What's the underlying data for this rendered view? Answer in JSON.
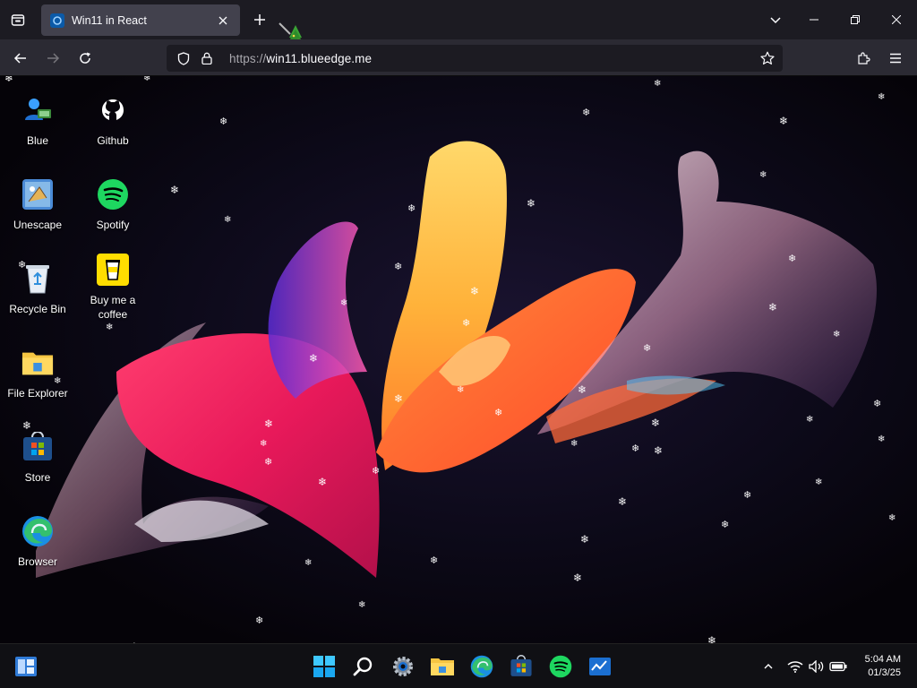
{
  "browser": {
    "tab_title": "Win11 in React",
    "url_dim": "https://",
    "url_main": "win11.blueedge.me"
  },
  "desktop": {
    "icons": [
      {
        "label": "Blue"
      },
      {
        "label": "Github"
      },
      {
        "label": "Unescape"
      },
      {
        "label": "Spotify"
      },
      {
        "label": "Recycle Bin"
      },
      {
        "label": "Buy me a coffee"
      },
      {
        "label": "File Explorer"
      },
      {
        "label": "Store"
      },
      {
        "label": "Browser"
      }
    ]
  },
  "taskbar": {
    "apps": [
      "widgets-icon",
      "start-icon",
      "search-icon",
      "settings-icon",
      "file-explorer-icon",
      "edge-icon",
      "store-icon",
      "spotify-icon",
      "whiteboard-icon"
    ],
    "tray": [
      "chevron-up-icon",
      "wifi-icon",
      "volume-icon",
      "battery-icon"
    ],
    "time": "5:04 AM",
    "date": "01/3/25"
  },
  "colors": {
    "accent": "#0b5aa8",
    "tab_bg": "#42414d",
    "toolbar_bg": "#2b2a33",
    "tabbar_bg": "#1c1b22",
    "taskbar_bg": "#101014"
  }
}
